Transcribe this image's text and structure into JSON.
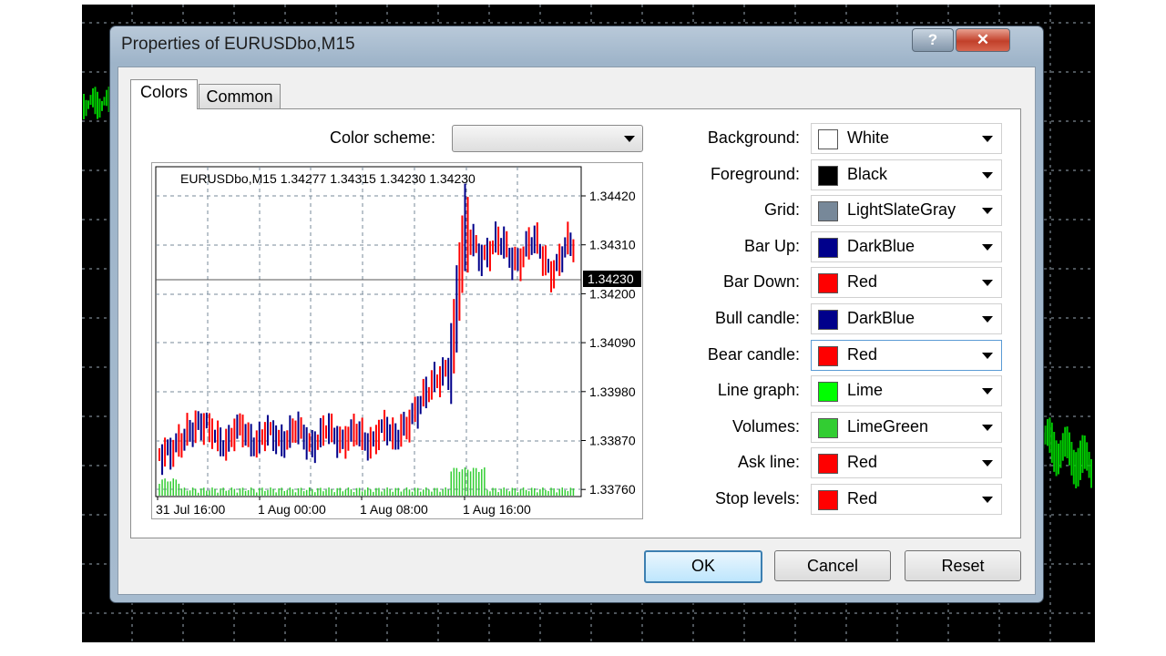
{
  "dialog": {
    "title": "Properties of EURUSDbo,M15",
    "help_glyph": "?",
    "close_glyph": "✕"
  },
  "tabs": [
    {
      "label": "Colors",
      "active": true
    },
    {
      "label": "Common",
      "active": false
    }
  ],
  "color_scheme": {
    "label": "Color scheme:",
    "value": ""
  },
  "preview": {
    "header": "EURUSDbo,M15  1.34277 1.34315 1.34230 1.34230",
    "price_ticks": [
      "1.34420",
      "1.34310",
      "1.34200",
      "1.34090",
      "1.33980",
      "1.33870",
      "1.33760"
    ],
    "current_price": "1.34230",
    "time_ticks": [
      "31 Jul 16:00",
      "1 Aug 00:00",
      "1 Aug 08:00",
      "1 Aug 16:00"
    ],
    "up_color": "#00008b",
    "down_color": "#ff0000",
    "volume_color": "#32cd32",
    "grid_color": "#778899"
  },
  "properties": [
    {
      "label": "Background:",
      "value": "White",
      "color": "#ffffff"
    },
    {
      "label": "Foreground:",
      "value": "Black",
      "color": "#000000"
    },
    {
      "label": "Grid:",
      "value": "LightSlateGray",
      "color": "#778899"
    },
    {
      "label": "Bar Up:",
      "value": "DarkBlue",
      "color": "#00008b"
    },
    {
      "label": "Bar Down:",
      "value": "Red",
      "color": "#ff0000"
    },
    {
      "label": "Bull candle:",
      "value": "DarkBlue",
      "color": "#00008b"
    },
    {
      "label": "Bear candle:",
      "value": "Red",
      "color": "#ff0000"
    },
    {
      "label": "Line graph:",
      "value": "Lime",
      "color": "#00ff00"
    },
    {
      "label": "Volumes:",
      "value": "LimeGreen",
      "color": "#32cd32"
    },
    {
      "label": "Ask line:",
      "value": "Red",
      "color": "#ff0000"
    },
    {
      "label": "Stop levels:",
      "value": "Red",
      "color": "#ff0000"
    }
  ],
  "buttons": {
    "ok": "OK",
    "cancel": "Cancel",
    "reset": "Reset"
  }
}
